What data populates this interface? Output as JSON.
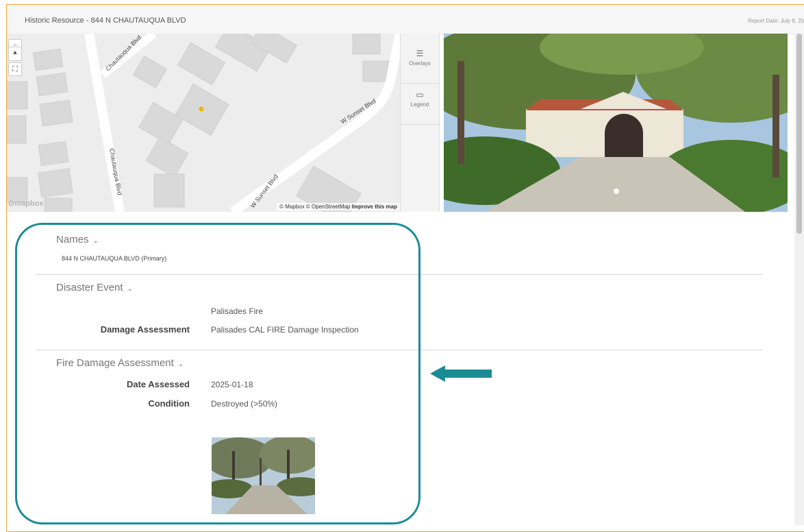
{
  "header": {
    "title": "Historic Resource - 844 N CHAUTAUQUA BLVD",
    "report_date": "Report Date: July 8, 20"
  },
  "map": {
    "street_labels": [
      "Chautauqua Blvd",
      "Chautauqua Blvd",
      "W Sunset Blvd",
      "W Sunset Blvd"
    ],
    "logo": "mapbox",
    "attribution": "© Mapbox © OpenStreetMap",
    "improve_link": "Improve this map",
    "zoom_symbol": "▲",
    "fullscreen_symbol": "⛶"
  },
  "tools": {
    "overlays_label": "Overlays",
    "legend_label": "Legend",
    "overlays_icon": "list-icon",
    "legend_icon": "legend-icon"
  },
  "sections": {
    "names": {
      "title": "Names",
      "primary_name": "844 N CHAUTAUQUA BLVD (Primary)"
    },
    "disaster_event": {
      "title": "Disaster Event",
      "event_value": "Palisades Fire",
      "damage_assessment_label": "Damage Assessment",
      "damage_assessment_value": "Palisades CAL FIRE Damage Inspection"
    },
    "fire_damage": {
      "title": "Fire Damage Assessment",
      "date_label": "Date Assessed",
      "date_value": "2025-01-18",
      "condition_label": "Condition",
      "condition_value": "Destroyed (>50%)"
    }
  },
  "colors": {
    "highlight": "#1a8c94",
    "frame": "#f0a830"
  }
}
